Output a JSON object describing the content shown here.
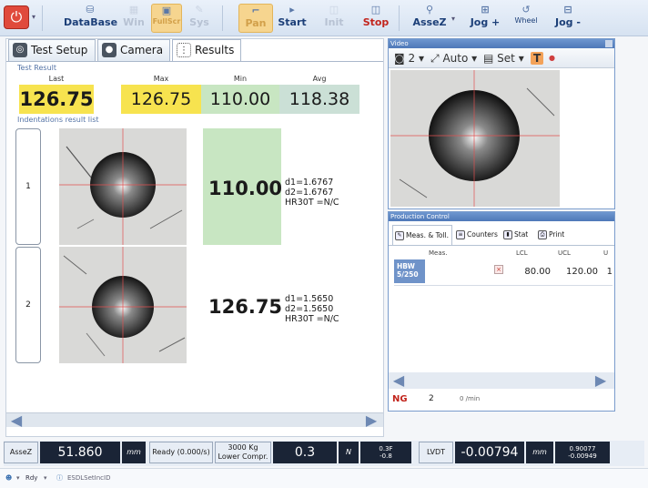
{
  "toolbar": {
    "database": "DataBase",
    "win": "Win",
    "fullscr": "FullScr",
    "sys": "Sys",
    "pan": "Pan",
    "start": "Start",
    "init": "Init",
    "stop": "Stop",
    "assez": "AsseZ",
    "jog_plus": "Jog +",
    "wheel": "Wheel",
    "jog_minus": "Jog -"
  },
  "tabs": [
    "Test Setup",
    "Camera",
    "Results"
  ],
  "test_result": {
    "section": "Test Result",
    "last_label": "Last",
    "last": "126.75",
    "max_label": "Max",
    "max": "126.75",
    "min_label": "Min",
    "min": "110.00",
    "avg_label": "Avg",
    "avg": "118.38"
  },
  "indentations": {
    "section": "Indentations result list",
    "items": [
      {
        "index": "1",
        "value": "110.00",
        "d1": "d1=1.6767",
        "d2": "d2=1.6767",
        "hr": "HR30T =N/C"
      },
      {
        "index": "2",
        "value": "126.75",
        "d1": "d1=1.5650",
        "d2": "d2=1.5650",
        "hr": "HR30T =N/C"
      }
    ]
  },
  "video": {
    "title": "Video",
    "cam": "2",
    "auto": "Auto",
    "set": "Set",
    "t": "T"
  },
  "production": {
    "title": "Production Control",
    "tabs": [
      "Meas. & Toll.",
      "Counters",
      "Stat",
      "Print"
    ],
    "headers": {
      "meas": "Meas.",
      "lcl": "LCL",
      "ucl": "UCL",
      "u": "U"
    },
    "row": {
      "name_line1": "HBW",
      "name_line2": "5/250",
      "lcl": "80.00",
      "ucl": "120.00",
      "u": "1"
    },
    "ng": "NG",
    "count": "2",
    "rate": "0 /min"
  },
  "status": {
    "axis": "AsseZ",
    "position": "51.860",
    "pos_unit": "mm",
    "ready": "Ready (0.000/s)",
    "load_line1": "3000 Kg",
    "load_line2": "Lower Compr.",
    "force": "0.3",
    "force_unit": "N",
    "force_small1": "0.3F",
    "force_small2": "-0.8",
    "lvdt": "LVDT",
    "lvdt_value": "-0.00794",
    "lvdt_unit": "mm",
    "lvdt_small1": "0.90077",
    "lvdt_small2": "-0.00949"
  },
  "bottom": {
    "rdy": "Rdy",
    "status_text": "ESDLSetIncID"
  }
}
